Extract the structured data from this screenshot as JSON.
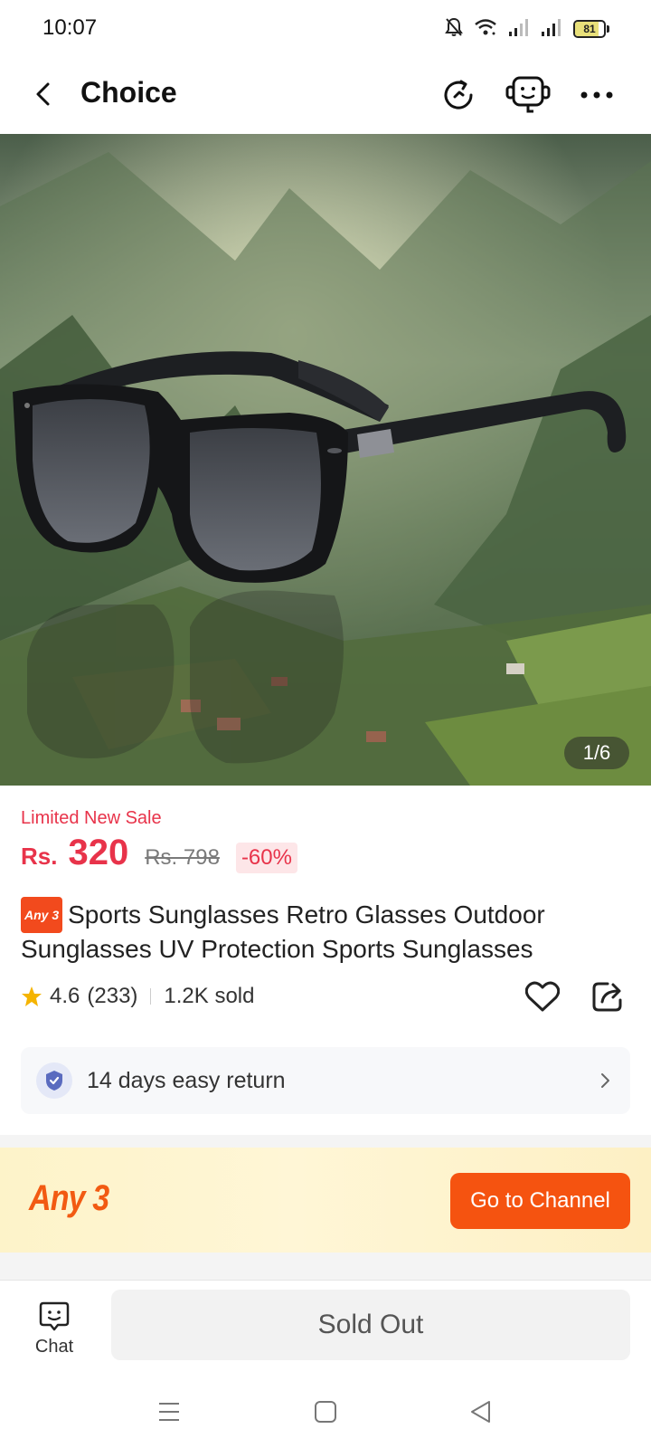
{
  "status_bar": {
    "time": "10:07",
    "battery_level": "81",
    "battery_fraction": 0.81,
    "icons": [
      "bell-off-icon",
      "wifi-icon",
      "signal-icon",
      "signal-icon",
      "battery-icon"
    ]
  },
  "nav": {
    "title": "Choice",
    "icons": [
      "back-arrow-icon",
      "history-icon",
      "customer-service-icon",
      "more-icon"
    ]
  },
  "gallery": {
    "counter": "1/6",
    "current": 1,
    "total": 6
  },
  "price": {
    "sale_label": "Limited New Sale",
    "currency": "Rs.",
    "amount": "320",
    "original": "Rs. 798",
    "discount": "-60%"
  },
  "product": {
    "tag": "Any 3",
    "title": "Sports Sunglasses Retro Glasses Outdoor Sunglasses UV Protection Sports Sunglasses"
  },
  "rating": {
    "score": "4.6",
    "count": "(233)",
    "sold": "1.2K sold"
  },
  "return_policy": {
    "text": "14 days easy return"
  },
  "banner": {
    "logo": "Any 3",
    "button": "Go to Channel"
  },
  "bottom_bar": {
    "chat_label": "Chat",
    "sold_out_label": "Sold Out"
  },
  "colors": {
    "accent_red": "#e8334a",
    "accent_orange": "#f55310",
    "banner_bg": "#fdf3c9"
  }
}
